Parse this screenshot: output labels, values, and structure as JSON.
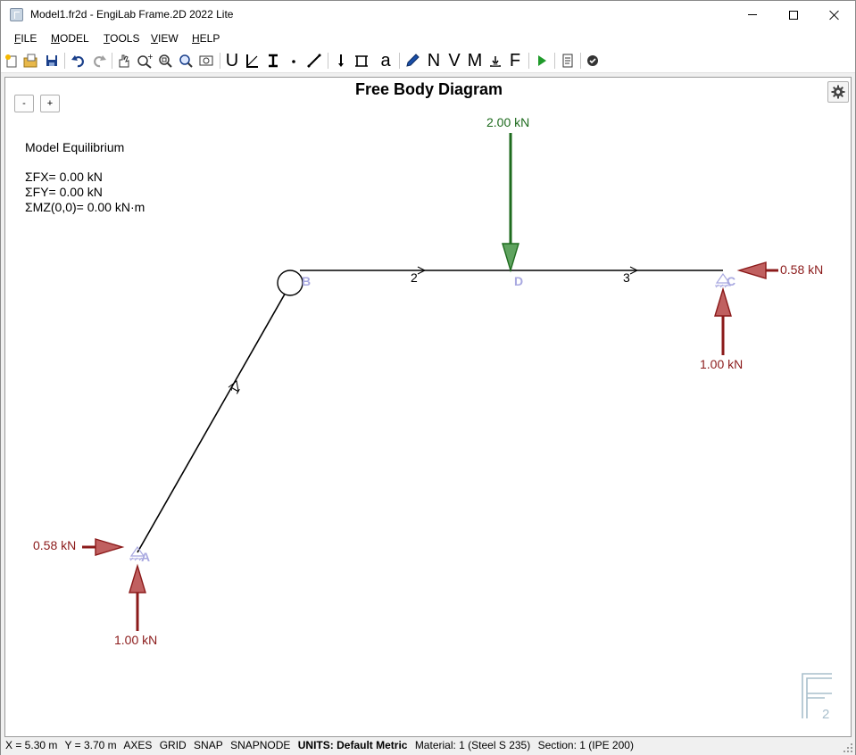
{
  "window": {
    "title": "Model1.fr2d - EngiLab Frame.2D 2022 Lite"
  },
  "menu": {
    "items": [
      {
        "label": "FILE",
        "accel": "F",
        "rest": "ILE"
      },
      {
        "label": "MODEL",
        "accel": "M",
        "rest": "ODEL"
      },
      {
        "label": "TOOLS",
        "accel": "T",
        "rest": "OOLS"
      },
      {
        "label": "VIEW",
        "accel": "V",
        "rest": "IEW"
      },
      {
        "label": "HELP",
        "accel": "H",
        "rest": "ELP"
      }
    ]
  },
  "toolbar": {
    "icons": [
      "new-file-icon",
      "open-file-icon",
      "save-icon",
      "undo-icon",
      "redo-icon",
      "pan-icon",
      "zoom-in-icon",
      "zoom-window-icon",
      "zoom-extents-icon",
      "zoom-previous-icon",
      "units-icon",
      "materials-icon",
      "sections-icon",
      "node-icon",
      "element-icon",
      "nodal-load-icon",
      "element-load-icon",
      "text-icon",
      "pencil-icon",
      "axial-force-icon",
      "shear-force-icon",
      "moment-icon",
      "reactions-icon",
      "free-body-icon",
      "run-analysis-icon",
      "report-icon",
      "check-icon"
    ],
    "letters": {
      "units": "U",
      "text": "a",
      "axial": "N",
      "shear": "V",
      "moment": "M",
      "fbd": "F"
    }
  },
  "canvas": {
    "zoom_out_label": "-",
    "zoom_in_label": "+",
    "title": "Free Body Diagram",
    "equilibrium": {
      "heading": "Model Equilibrium",
      "sum_fx": "ΣFX= 0.00 kN",
      "sum_fy": "ΣFY= 0.00 kN",
      "sum_mz": "ΣMZ(0,0)= 0.00 kN·m"
    },
    "nodes": {
      "a": "A",
      "b": "B",
      "c": "C",
      "d": "D"
    },
    "elements": {
      "e1": "1",
      "e2": "2",
      "e3": "3"
    },
    "loads": {
      "applied_d": "2.00 kN",
      "reaction_ax": "0.58 kN",
      "reaction_ay": "1.00 kN",
      "reaction_cx": "0.58 kN",
      "reaction_cy": "1.00 kN"
    },
    "colors": {
      "reaction": "#8b1a1a",
      "applied": "#1e6b1e",
      "node_label": "#a8a8e0"
    },
    "logo_text": "2"
  },
  "status": {
    "x": "X = 5.30 m",
    "y": "Y = 3.70 m",
    "axes": "AXES",
    "grid": "GRID",
    "snap": "SNAP",
    "snapnode": "SNAPNODE",
    "units_label": "UNITS:",
    "units_value": "Default Metric",
    "material": "Material: 1 (Steel S 235)",
    "section": "Section: 1 (IPE 200)"
  }
}
